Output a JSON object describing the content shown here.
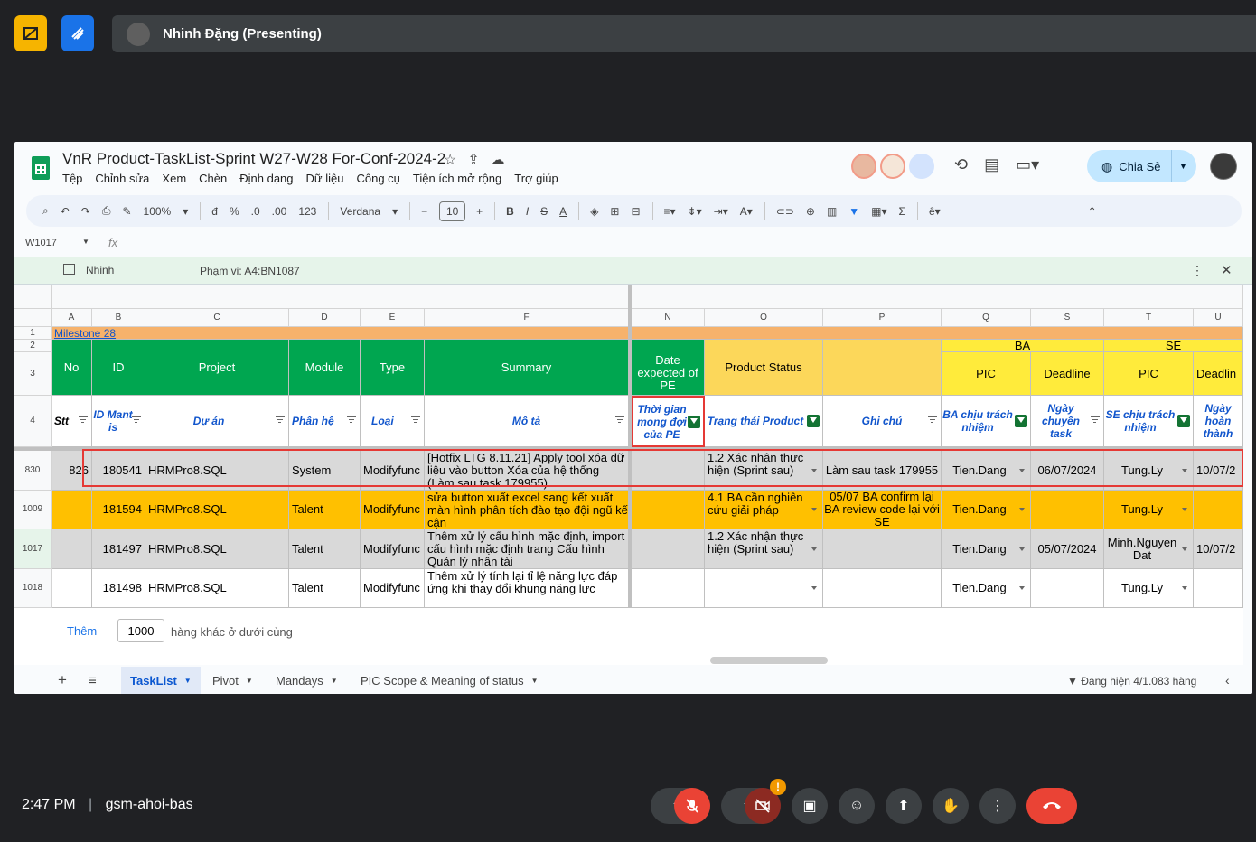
{
  "meet": {
    "presenter_name": "Nhinh Đặng (Presenting)",
    "clock": "2:47 PM",
    "divider": "|",
    "meeting_code": "gsm-ahoi-bas",
    "mic_badge": "!",
    "colors": {
      "bg": "#202124",
      "bar": "#3c4043",
      "end_call": "#ea4335",
      "app1": "#f6b400",
      "app2": "#1a73e8"
    }
  },
  "sheet": {
    "title": "VnR Product-TaskList-Sprint W27-W28 For-Conf-2024-2",
    "menu": [
      "Tệp",
      "Chỉnh sửa",
      "Xem",
      "Chèn",
      "Định dạng",
      "Dữ liệu",
      "Công cụ",
      "Tiện ích mở rộng",
      "Trợ giúp"
    ],
    "share_label": "Chia Sẻ",
    "toolbar": {
      "zoom": "100%",
      "currency": "đ",
      "percent": "%",
      "dec_less": ".0",
      "dec_more": ".00",
      "format_123": "123",
      "font": "Verdana",
      "font_size": "10"
    },
    "name_box": "W1017",
    "fx": "fx",
    "filter_view": {
      "name": "Nhinh",
      "range": "Phạm vi: A4:BN1087"
    },
    "col_headers": [
      "A",
      "B",
      "C",
      "D",
      "E",
      "F",
      "N",
      "O",
      "P",
      "Q",
      "S",
      "T",
      "U"
    ],
    "row_headers": [
      "1",
      "2",
      "3",
      "4",
      "830",
      "1009",
      "1017",
      "1018"
    ],
    "milestone": "Milestone 28",
    "header_row3": {
      "no": "No",
      "id": "ID",
      "project": "Project",
      "module": "Module",
      "type": "Type",
      "summary": "Summary",
      "date_expected": "Date expected of PE",
      "product_status": "Product Status",
      "ba": "BA",
      "se": "SE",
      "pic_ba": "PIC",
      "deadline_ba": "Deadline",
      "pic_se": "PIC",
      "deadline_se": "Deadlin"
    },
    "header_row4": {
      "stt": "Stt",
      "id_mantis": "ID Mant is",
      "du_an": "Dự án",
      "phan_he": "Phân hệ",
      "loai": "Loại",
      "mo_ta": "Mô tả",
      "thoi_gian": "Thời gian mong đợi của PE",
      "trang_thai": "Trạng thái Product",
      "ghi_chu": "Ghi chú",
      "ba_chiu": "BA chịu trách nhiệm",
      "ngay_chuyen": "Ngày chuyển task",
      "se_chiu": "SE chịu trách nhiệm",
      "ngay_hoan": "Ngày hoàn thành"
    },
    "rows": [
      {
        "stt": "826",
        "id": "180541",
        "project": "HRMPro8.SQL",
        "module": "System",
        "type": "Modifyfunc",
        "summary": "[Hotfix LTG 8.11.21] Apply tool xóa dữ liệu vào button Xóa của hệ thống (Làm sau task 179955)",
        "date": "",
        "status": "1.2 Xác nhận thực hiện (Sprint sau)",
        "note": "Làm sau task 179955",
        "ba": "Tien.Dang",
        "deadline": "06/07/2024",
        "se": "Tung.Ly",
        "done": "10/07/2"
      },
      {
        "stt": "",
        "id": "181594",
        "project": "HRMPro8.SQL",
        "module": "Talent",
        "type": "Modifyfunc",
        "summary": "sửa button xuất excel sang kết xuất màn hình phân tích đào tạo đội ngũ kế cận",
        "date": "",
        "status": "4.1 BA cần nghiên cứu giải pháp",
        "note": "05/07 BA confirm lại BA review code lại với SE",
        "ba": "Tien.Dang",
        "deadline": "",
        "se": "Tung.Ly",
        "done": ""
      },
      {
        "stt": "",
        "id": "181497",
        "project": "HRMPro8.SQL",
        "module": "Talent",
        "type": "Modifyfunc",
        "summary": "Thêm xử lý cấu hình mặc định, import cấu hình mặc định trang Cấu hình Quản lý nhân tài",
        "date": "",
        "status": "1.2 Xác nhận thực hiện (Sprint sau)",
        "note": "",
        "ba": "Tien.Dang",
        "deadline": "05/07/2024",
        "se": "Minh.Nguyen Dat",
        "done": "10/07/2"
      },
      {
        "stt": "",
        "id": "181498",
        "project": "HRMPro8.SQL",
        "module": "Talent",
        "type": "Modifyfunc",
        "summary": "Thêm xử lý tính lại tỉ lệ năng lực đáp ứng khi thay đổi khung năng lực",
        "date": "",
        "status": "",
        "note": "",
        "ba": "Tien.Dang",
        "deadline": "",
        "se": "Tung.Ly",
        "done": ""
      }
    ],
    "add_rows": {
      "button": "Thêm",
      "count": "1000",
      "suffix": "hàng khác ở dưới cùng"
    },
    "tabs": [
      "TaskList",
      "Pivot",
      "Mandays",
      "PIC Scope & Meaning of status"
    ],
    "filter_status": "Đang hiện 4/1.083 hàng"
  }
}
